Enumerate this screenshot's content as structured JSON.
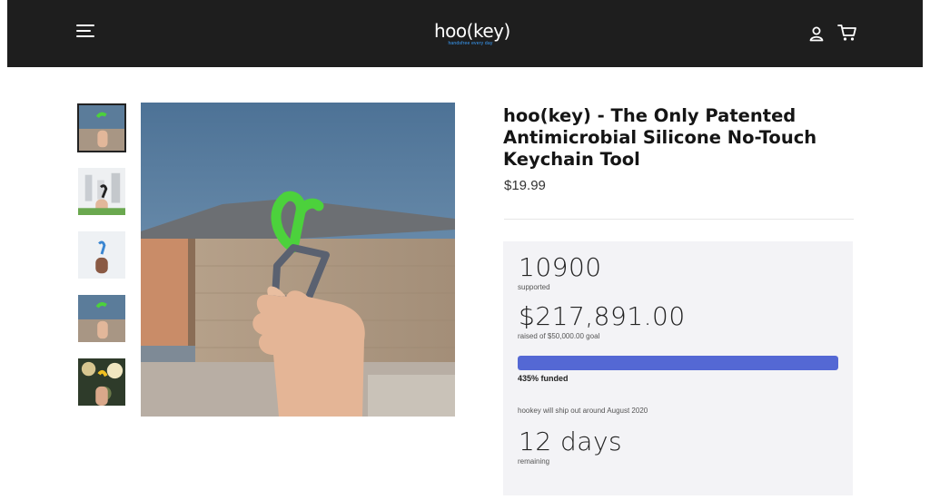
{
  "header": {
    "logo_text": "hoo(key)",
    "logo_tagline": "handsfree every day",
    "menu_icon": "hamburger-menu-icon",
    "account_icon": "user-icon",
    "cart_icon": "cart-icon"
  },
  "product": {
    "title": "hoo(key) - The Only Patented Antimicrobial Silicone No-Touch Keychain Tool",
    "price": "$19.99"
  },
  "funding": {
    "supporters_count": "10900",
    "supporters_label": "supported",
    "raised_amount": "$217,891.00",
    "goal_text": "raised of $50,000.00 goal",
    "percent_funded": 435,
    "percent_funded_text": "435% funded",
    "ship_text": "hookey will ship out around August 2020",
    "days_remaining": "12 days",
    "remaining_label": "remaining"
  },
  "colors": {
    "header_bg": "#1e1e1e",
    "progress_bar": "#5468d4",
    "product_green": "#4cd13c",
    "funding_panel_bg": "#f3f3f6"
  }
}
